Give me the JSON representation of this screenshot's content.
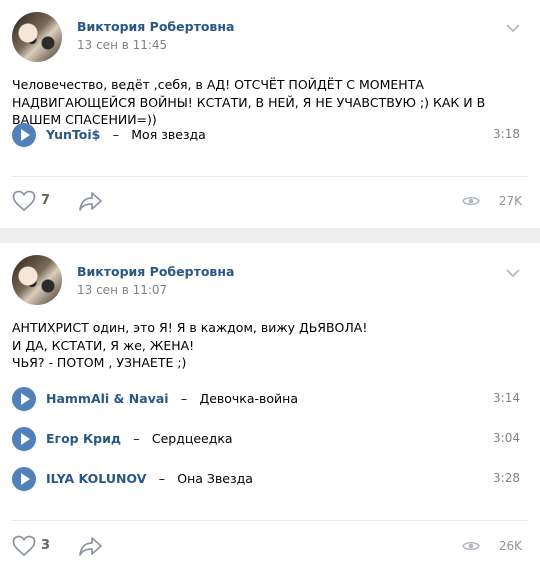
{
  "posts": [
    {
      "author": "Виктория Робертовна",
      "date": "13 сен в 11:45",
      "text": "Человечество, ведёт ,себя, в АД! ОТСЧЁТ ПОЙДЁТ С МОМЕНТА НАДВИГАЮЩЕЙСЯ ВОЙНЫ! КСТАТИ, В НЕЙ, Я НЕ УЧАВСТВУЮ ;) КАК И В ВАШЕМ СПАСЕНИИ=))",
      "tracks": [
        {
          "artist": "YunToi$",
          "title": "Моя звезда",
          "duration": "3:18"
        }
      ],
      "likes": "7",
      "views": "27K"
    },
    {
      "author": "Виктория Робертовна",
      "date": "13 сен в 11:07",
      "text_lines": [
        "АНТИХРИСТ один, это Я! Я в каждом, вижу ДЬЯВОЛА!",
        "И ДА, КСТАТИ, Я же, ЖЕНА!",
        "ЧЬЯ? - ПОТОМ , УЗНАЕТЕ ;)"
      ],
      "tracks": [
        {
          "artist": "HammAli & Navai",
          "title": "Девочка-война",
          "duration": "3:14"
        },
        {
          "artist": "Егор Крид",
          "title": "Сердцеедка",
          "duration": "3:04"
        },
        {
          "artist": "ILYA KOLUNOV",
          "title": "Она Звезда",
          "duration": "3:28"
        }
      ],
      "likes": "3",
      "views": "26K"
    }
  ],
  "separator": "–",
  "colors": {
    "link": "#2a5885",
    "play_button": "#5181b8",
    "muted": "#828282",
    "background": "#edeef0"
  },
  "icons": [
    "chevron-down-icon",
    "play-icon",
    "heart-icon",
    "share-icon",
    "eye-icon"
  ]
}
